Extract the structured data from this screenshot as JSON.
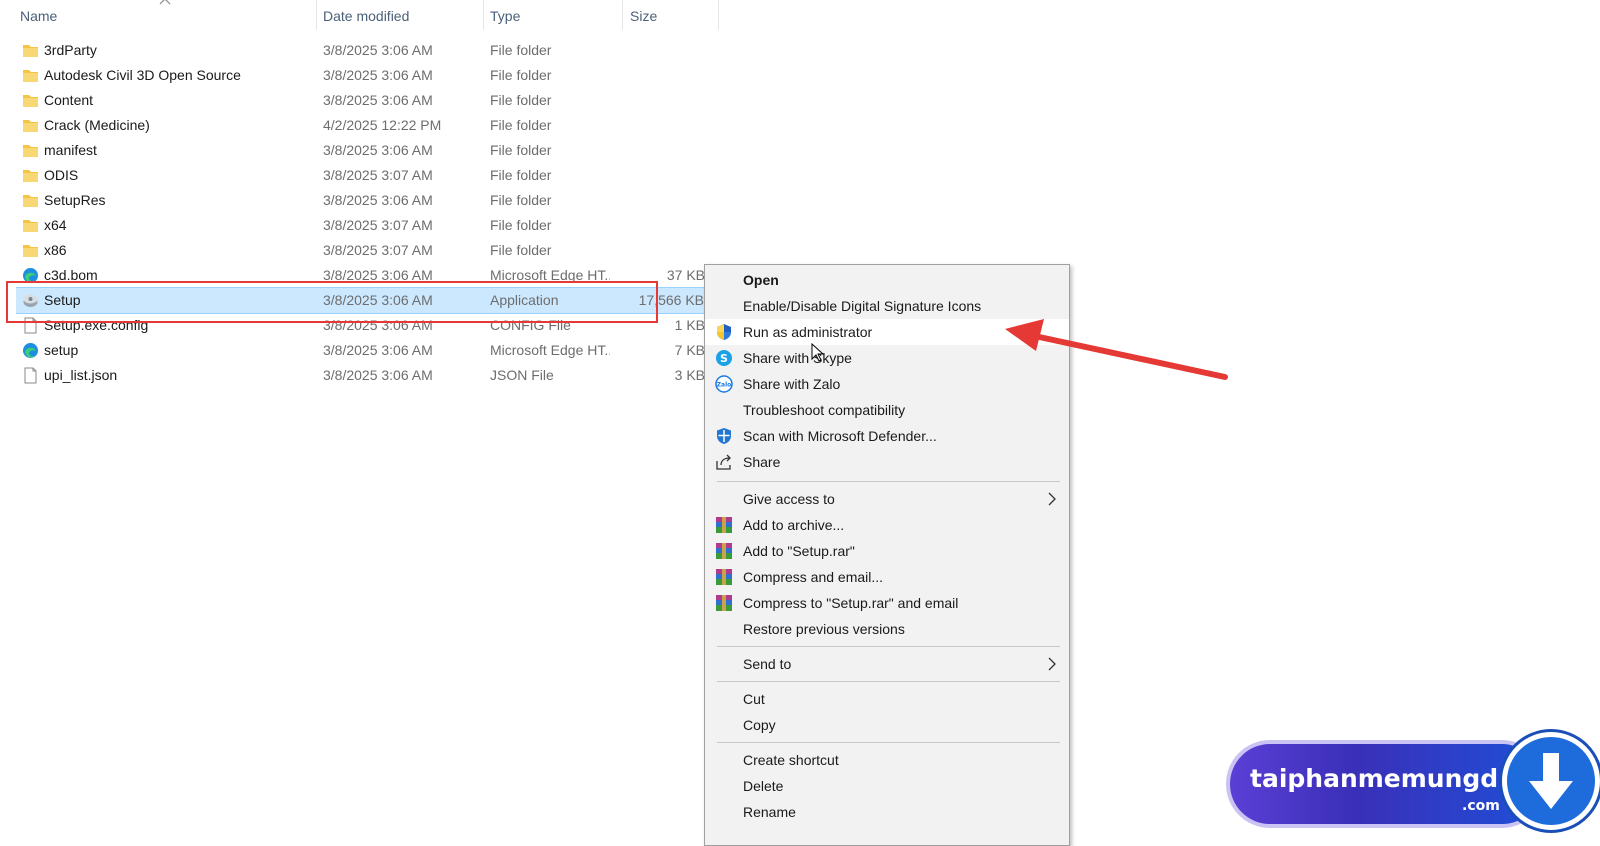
{
  "columns": {
    "name": "Name",
    "date": "Date modified",
    "type": "Type",
    "size": "Size"
  },
  "files": [
    {
      "name": "3rdParty",
      "date": "3/8/2025 3:06 AM",
      "type": "File folder",
      "size": "",
      "icon": "folder-icon"
    },
    {
      "name": "Autodesk Civil 3D Open Source",
      "date": "3/8/2025 3:06 AM",
      "type": "File folder",
      "size": "",
      "icon": "folder-icon"
    },
    {
      "name": "Content",
      "date": "3/8/2025 3:06 AM",
      "type": "File folder",
      "size": "",
      "icon": "folder-icon"
    },
    {
      "name": "Crack (Medicine)",
      "date": "4/2/2025 12:22 PM",
      "type": "File folder",
      "size": "",
      "icon": "folder-icon"
    },
    {
      "name": "manifest",
      "date": "3/8/2025 3:06 AM",
      "type": "File folder",
      "size": "",
      "icon": "folder-icon"
    },
    {
      "name": "ODIS",
      "date": "3/8/2025 3:07 AM",
      "type": "File folder",
      "size": "",
      "icon": "folder-icon"
    },
    {
      "name": "SetupRes",
      "date": "3/8/2025 3:06 AM",
      "type": "File folder",
      "size": "",
      "icon": "folder-icon"
    },
    {
      "name": "x64",
      "date": "3/8/2025 3:07 AM",
      "type": "File folder",
      "size": "",
      "icon": "folder-icon"
    },
    {
      "name": "x86",
      "date": "3/8/2025 3:07 AM",
      "type": "File folder",
      "size": "",
      "icon": "folder-icon"
    },
    {
      "name": "c3d.bom",
      "date": "3/8/2025 3:06 AM",
      "type": "Microsoft Edge HT...",
      "size": "37 KB",
      "icon": "edge-icon"
    },
    {
      "name": "Setup",
      "date": "3/8/2025 3:06 AM",
      "type": "Application",
      "size": "17,566 KB",
      "icon": "setup-app-icon"
    },
    {
      "name": "Setup.exe.config",
      "date": "3/8/2025 3:06 AM",
      "type": "CONFIG File",
      "size": "1 KB",
      "icon": "file-icon"
    },
    {
      "name": "setup",
      "date": "3/8/2025 3:06 AM",
      "type": "Microsoft Edge HT...",
      "size": "7 KB",
      "icon": "edge-icon"
    },
    {
      "name": "upi_list.json",
      "date": "3/8/2025 3:06 AM",
      "type": "JSON File",
      "size": "3 KB",
      "icon": "file-icon"
    }
  ],
  "context_menu": {
    "items": [
      {
        "label": "Open",
        "icon": ""
      },
      {
        "label": "Enable/Disable Digital Signature Icons",
        "icon": ""
      },
      {
        "label": "Run as administrator",
        "icon": "uac-shield-icon"
      },
      {
        "label": "Share with Skype",
        "icon": "skype-icon"
      },
      {
        "label": "Share with Zalo",
        "icon": "zalo-icon"
      },
      {
        "label": "Troubleshoot compatibility",
        "icon": ""
      },
      {
        "label": "Scan with Microsoft Defender...",
        "icon": "defender-icon"
      },
      {
        "label": "Share",
        "icon": "share-icon"
      },
      {
        "label": "Give access to",
        "icon": ""
      },
      {
        "label": "Add to archive...",
        "icon": "winrar-icon"
      },
      {
        "label": "Add to \"Setup.rar\"",
        "icon": "winrar-icon"
      },
      {
        "label": "Compress and email...",
        "icon": "winrar-icon"
      },
      {
        "label": "Compress to \"Setup.rar\" and email",
        "icon": "winrar-icon"
      },
      {
        "label": "Restore previous versions",
        "icon": ""
      },
      {
        "label": "Send to",
        "icon": ""
      },
      {
        "label": "Cut",
        "icon": ""
      },
      {
        "label": "Copy",
        "icon": ""
      },
      {
        "label": "Create shortcut",
        "icon": ""
      },
      {
        "label": "Delete",
        "icon": ""
      },
      {
        "label": "Rename",
        "icon": ""
      }
    ]
  },
  "watermark": {
    "text": "taiphanmemungdung",
    "suffix": ".com"
  },
  "colors": {
    "selection": "#cce8ff",
    "highlight_box": "#e53935",
    "annotation_arrow": "#e53935",
    "folder": "#f4c542"
  }
}
